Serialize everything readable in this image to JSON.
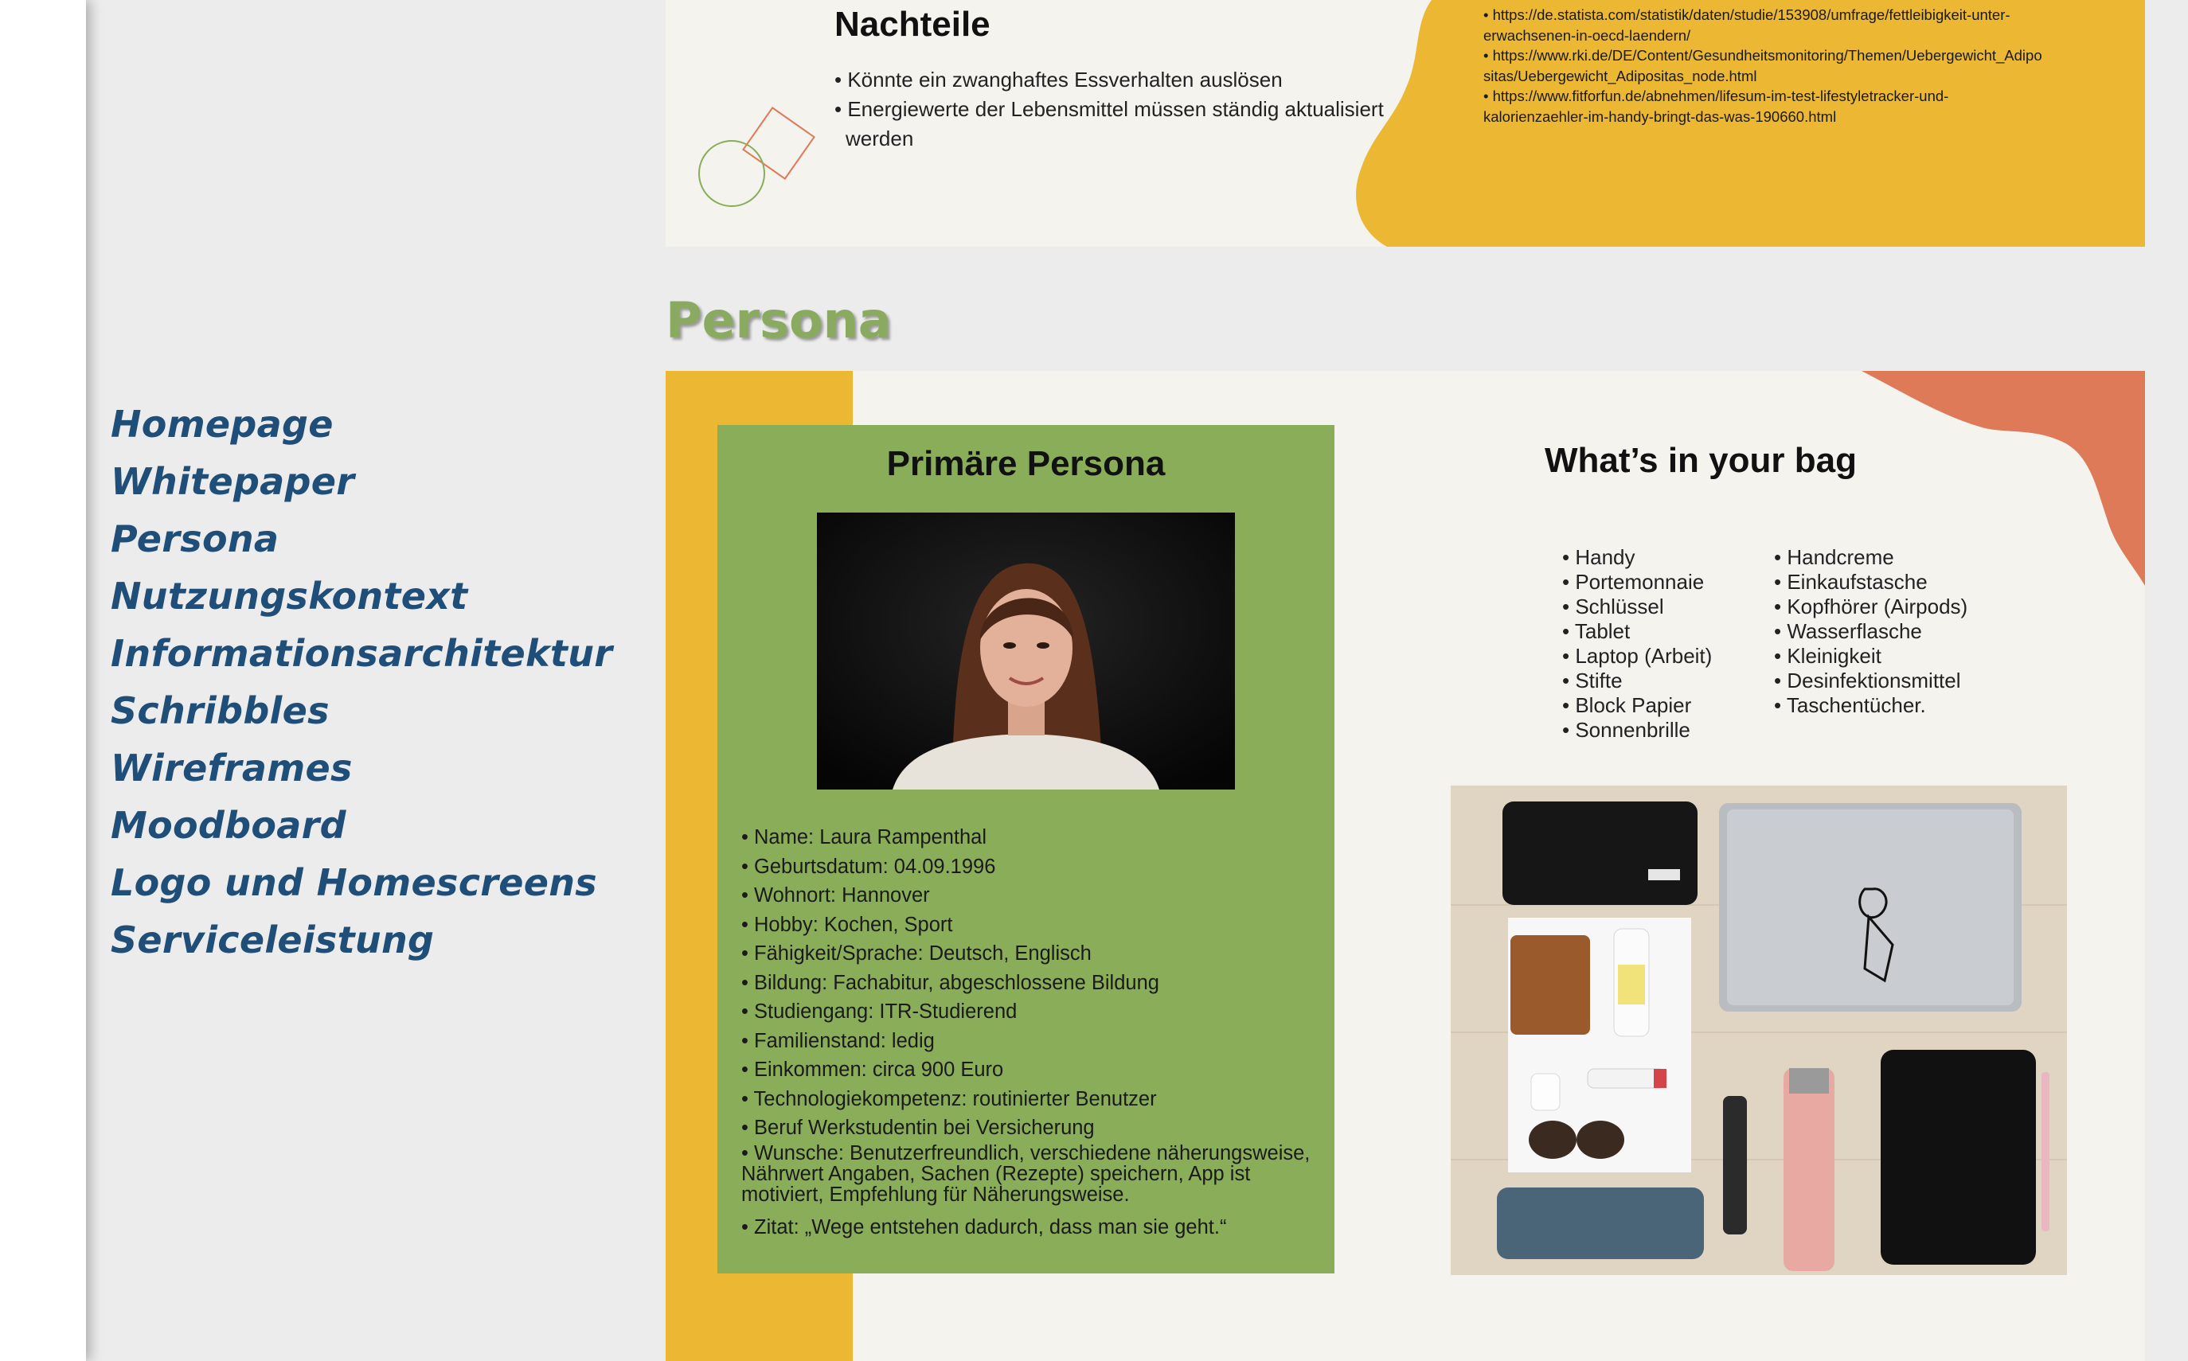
{
  "sidebar": {
    "items": [
      {
        "label": "Homepage"
      },
      {
        "label": "Whitepaper"
      },
      {
        "label": "Persona"
      },
      {
        "label": "Nutzungskontext"
      },
      {
        "label": "Informationsarchitektur"
      },
      {
        "label": "Schribbles"
      },
      {
        "label": "Wireframes"
      },
      {
        "label": "Moodboard"
      },
      {
        "label": "Logo und Homescreens"
      },
      {
        "label": "Serviceleistung"
      }
    ]
  },
  "top_slide": {
    "title": "Nachteile",
    "bullets": [
      "• Könnte ein zwanghaftes Essverhalten auslösen",
      "• Energiewerte der Lebensmittel müssen ständig aktualisiert werden"
    ],
    "sources": [
      "•  https://de.statista.com/statistik/daten/studie/153908/umfrage/fettleibigkeit-unter- erwachsenen-in-oecd-laendern/",
      "•  https://www.rki.de/DE/Content/Gesundheitsmonitoring/Themen/Uebergewicht_Adipo sitas/Uebergewicht_Adipositas_node.html",
      "•  https://www.fitforfun.de/abnehmen/lifesum-im-test-lifestyletracker-und- kalorienzaehler-im-handy-bringt-das-was-190660.html"
    ]
  },
  "persona_section": {
    "heading": "Persona",
    "card": {
      "title": "Primäre Persona",
      "facts": [
        "• Name: Laura Rampenthal",
        "• Geburtsdatum: 04.09.1996",
        "• Wohnort: Hannover",
        "• Hobby: Kochen, Sport",
        "• Fähigkeit/Sprache: Deutsch, Englisch",
        "• Bildung: Fachabitur, abgeschlossene Bildung",
        "• Studiengang: ITR-Studierend",
        "• Familienstand: ledig",
        "• Einkommen: circa 900 Euro",
        "• Technologiekompetenz: routinierter Benutzer",
        "• Beruf Werkstudentin bei Versicherung"
      ],
      "wishes": "• Wunsche: Benutzerfreundlich, verschiedene näherungsweise, Nährwert Angaben, Sachen (Rezepte) speichern, App ist motiviert, Empfehlung für Näherungsweise.",
      "quote": "• Zitat: „Wege entstehen dadurch, dass man sie geht.“"
    },
    "bag": {
      "title": "What’s in your bag",
      "col1": [
        "• Handy",
        "• Portemonnaie",
        "• Schlüssel",
        "• Tablet",
        "• Laptop (Arbeit)",
        "• Stifte",
        "• Block Papier",
        "• Sonnenbrille"
      ],
      "col2": [
        "• Handcreme",
        "• Einkaufstasche",
        "• Kopfhörer (Airpods)",
        "• Wasserflasche",
        "• Kleinigkeit",
        "• Desinfektionsmittel",
        "• Taschentücher."
      ]
    }
  },
  "colors": {
    "yellow": "#ecb833",
    "green": "#8aad5a",
    "orange": "#de7a58",
    "nav_blue": "#1f4e79",
    "slide_bg": "#f5f3ee"
  }
}
